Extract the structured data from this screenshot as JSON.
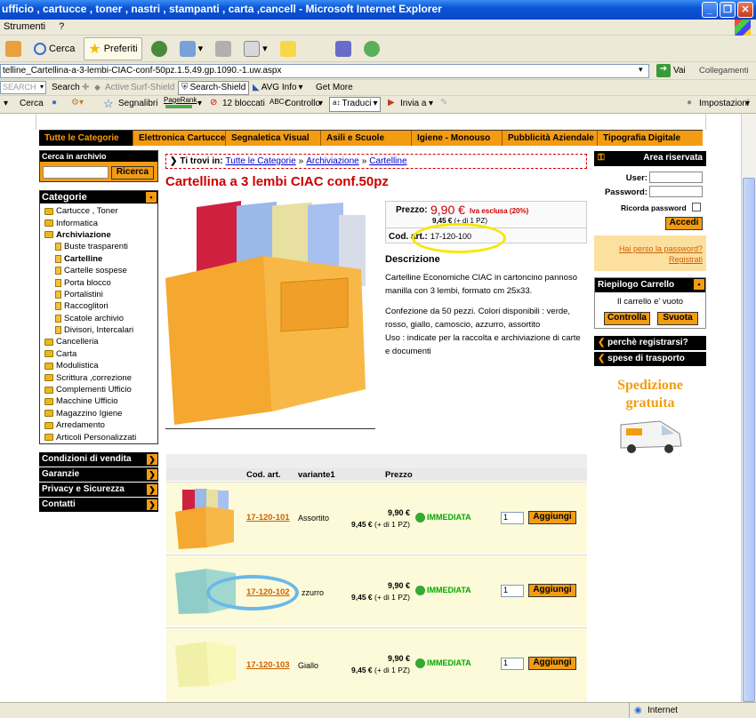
{
  "window": {
    "title": "ufficio , cartucce , toner , nastri , stampanti , carta ,cancell - Microsoft Internet Explorer"
  },
  "menu": {
    "items": [
      "Strumenti",
      "?"
    ]
  },
  "toolbar": {
    "search": "Cerca",
    "favorites": "Preferiti"
  },
  "address": {
    "url": "telline_Cartellina-a-3-lembi-CIAC-conf-50pz.1.5.49.gp.1090.-1.uw.aspx",
    "go": "Vai",
    "links": "Collegamenti"
  },
  "toolbar2": {
    "search_box": "SEARCH",
    "search": "Search",
    "active": "Active",
    "surf": "Surf-Shield",
    "search_shield": "Search-Shield",
    "avg": "AVG Info",
    "get_more": "Get More"
  },
  "toolbar3": {
    "cerca": "Cerca",
    "segnalibri": "Segnalibri",
    "pagerank": "PageRank",
    "bloccati": "12 bloccati",
    "controllo": "Controllo",
    "traduci": "Traduci",
    "invia": "Invia a",
    "impostazioni": "Impostazioni"
  },
  "nav": [
    "Tutte le Categorie",
    "Elettronica Cartucce",
    "Segnaletica Visual",
    "Asili e Scuole",
    "Igiene - Monouso",
    "Pubblicità Aziendale",
    "Tipografia Digitale"
  ],
  "archive": {
    "label": "Cerca in archivio",
    "button": "Ricerca"
  },
  "categories": {
    "title": "Categorie",
    "items": [
      "Cartucce , Toner",
      "Informatica",
      "Archiviazione",
      "Buste trasparenti",
      "Cartelline",
      "Cartelle sospese",
      "Porta blocco",
      "Portalistini",
      "Raccoglitori",
      "Scatole archivio",
      "Divisori, Intercalari",
      "Cancelleria",
      "Carta",
      "Modulistica",
      "Scrittura ,correzione",
      "Complementi Ufficio",
      "Macchine Ufficio",
      "Magazzino Igiene",
      "Arredamento",
      "Articoli Personalizzati"
    ]
  },
  "left_links": [
    "Condizioni di vendita",
    "Garanzie",
    "Privacy e Sicurezza",
    "Contatti"
  ],
  "breadcrumb": {
    "label": "Ti trovi in:",
    "items": [
      "Tutte le Categorie",
      "Archiviazione",
      "Cartelline"
    ],
    "sep": "»"
  },
  "product": {
    "title": "Cartellina a 3 lembi CIAC conf.50pz",
    "price_label": "Prezzo:",
    "price": "9,90 €",
    "vat_note": "Iva esclusa (20%)",
    "price2": "9,45 €",
    "qty_note": "(+ di 1 PZ)",
    "code_label": "Cod. art.:",
    "code": "17-120-100",
    "desc_title": "Descrizione",
    "desc": [
      "Cartelline Economiche CIAC in cartoncino pannoso manilla con 3 lembi, formato cm 25x33.",
      "Confezione da 50 pezzi. Colori disponibili : verde, rosso, giallo, camoscio, azzurro, assortito",
      "Uso : indicate per la raccolta e archiviazione di carte e documenti"
    ]
  },
  "table": {
    "headers": [
      "Cod. art.",
      "variante1",
      "Prezzo"
    ],
    "rows": [
      {
        "code": "17-120-101",
        "variant": "Assortito",
        "price": "9,90 €",
        "price2": "9,45 €",
        "note": "(+ di 1 PZ)",
        "stock": "IMMEDIATA",
        "qty": "1",
        "button": "Aggiungi"
      },
      {
        "code": "17-120-102",
        "variant": "zzurro",
        "price": "9,90 €",
        "price2": "9,45 €",
        "note": "(+ di 1 PZ)",
        "stock": "IMMEDIATA",
        "qty": "1",
        "button": "Aggiungi"
      },
      {
        "code": "17-120-103",
        "variant": "Giallo",
        "price": "9,90 €",
        "price2": "9,45 €",
        "note": "(+ di 1 PZ)",
        "stock": "IMMEDIATA",
        "qty": "1",
        "button": "Aggiungi"
      }
    ]
  },
  "reserved": {
    "title": "Area riservata",
    "user": "User:",
    "password": "Password:",
    "remember": "Ricorda password",
    "login": "Accedi",
    "lost": "Hai perso la password?",
    "register": "Registrati"
  },
  "cart": {
    "title": "Riepilogo Carrello",
    "empty": "Il carrello e' vuoto",
    "check": "Controlla",
    "empty_btn": "Svuota"
  },
  "right_links": [
    "perchè registrarsi?",
    "spese di trasporto"
  ],
  "shipping": {
    "line1": "Spedizione",
    "line2": "gratuita"
  },
  "status": {
    "zone": "Internet"
  }
}
